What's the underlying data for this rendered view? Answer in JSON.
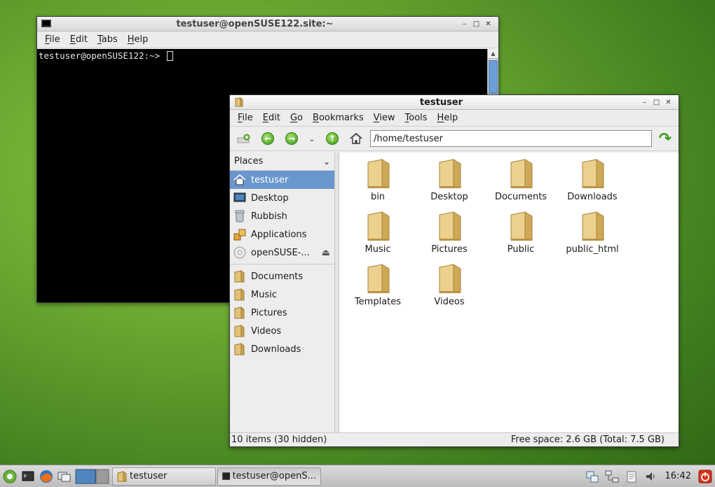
{
  "terminal": {
    "title": "testuser@openSUSE122.site:~",
    "menu": [
      "File",
      "Edit",
      "Tabs",
      "Help"
    ],
    "prompt": "testuser@openSUSE122:~>"
  },
  "filemanager": {
    "title": "testuser",
    "menu": [
      "File",
      "Edit",
      "Go",
      "Bookmarks",
      "View",
      "Tools",
      "Help"
    ],
    "address": "/home/testuser",
    "places_label": "Places",
    "places": [
      "testuser",
      "Desktop",
      "Rubbish",
      "Applications",
      "openSUSE-..."
    ],
    "bookmarks": [
      "Documents",
      "Music",
      "Pictures",
      "Videos",
      "Downloads"
    ],
    "files": [
      "bin",
      "Desktop",
      "Documents",
      "Downloads",
      "Music",
      "Pictures",
      "Public",
      "public_html",
      "Templates",
      "Videos"
    ],
    "status_left": "10 items (30 hidden)",
    "status_right": "Free space: 2.6 GB (Total: 7.5 GB)"
  },
  "taskbar": {
    "tasks": [
      "testuser",
      "testuser@openS..."
    ],
    "clock": "16:42"
  },
  "colors": {
    "selection": "#6996cd",
    "accent_green": "#3c9a1a",
    "folder": "#e2c27a"
  }
}
